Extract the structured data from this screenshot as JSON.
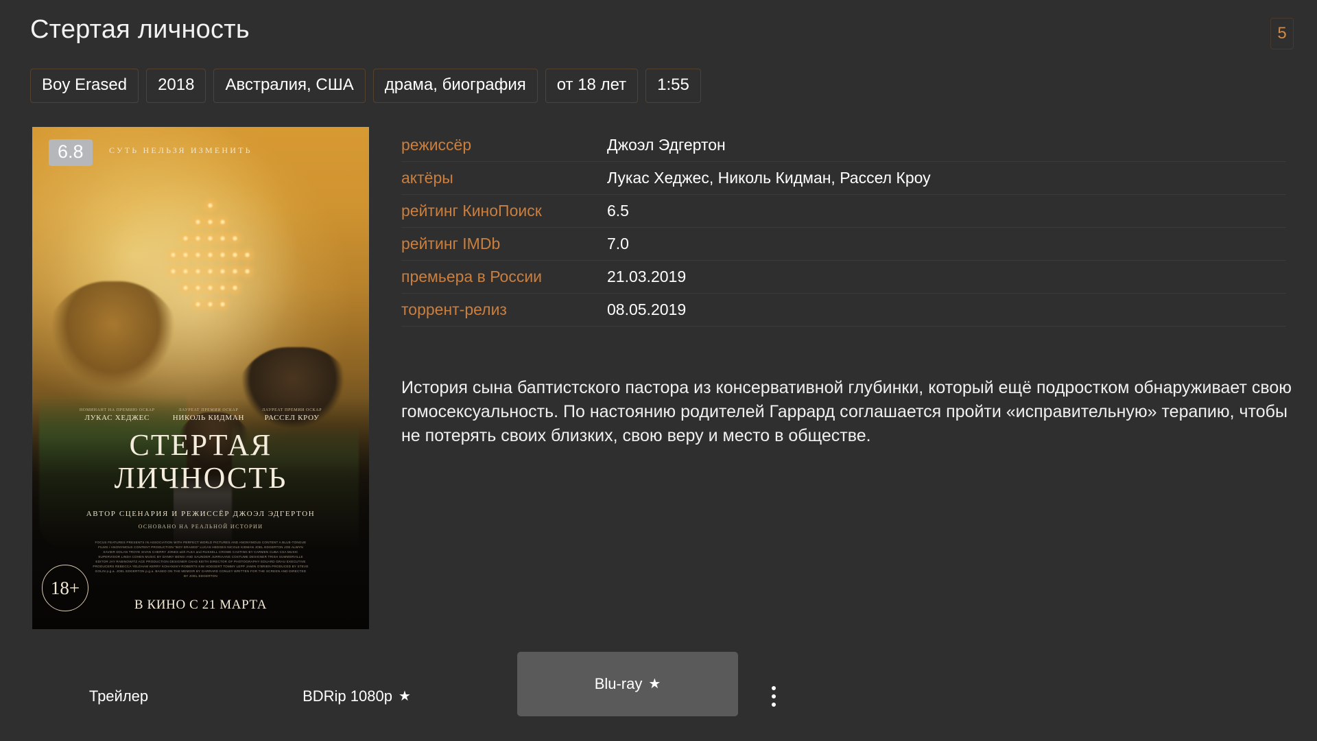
{
  "header": {
    "title": "Стертая личность",
    "count_badge": "5"
  },
  "chips": [
    {
      "label": "Boy Erased"
    },
    {
      "label": "2018"
    },
    {
      "label": "Австралия, США"
    },
    {
      "label": "драма, биография"
    },
    {
      "label": "от 18 лет"
    },
    {
      "label": "1:55"
    }
  ],
  "poster": {
    "score": "6.8",
    "tagline": "СУТЬ НЕЛЬЗЯ ИЗМЕНИТЬ",
    "credits": [
      {
        "award": "НОМИНАНТ НА ПРЕМИЮ ОСКАР",
        "name": "ЛУКАС ХЕДЖЕС"
      },
      {
        "award": "ЛАУРЕАТ ПРЕМИИ ОСКАР",
        "name": "НИКОЛЬ КИДМАН"
      },
      {
        "award": "ЛАУРЕАТ ПРЕМИИ ОСКАР",
        "name": "РАССЕЛ КРОУ"
      }
    ],
    "title_line1": "СТЕРТАЯ",
    "title_line2": "ЛИЧНОСТЬ",
    "director_credit": "АВТОР СЦЕНАРИЯ И РЕЖИССЁР ДЖОЭЛ ЭДГЕРТОН",
    "based_on": "ОСНОВАНО НА РЕАЛЬНОЙ ИСТОРИИ",
    "billing_block": "FOCUS FEATURES PRESENTS IN ASSOCIATION WITH PERFECT WORLD PICTURES AND ANONYMOUS CONTENT A BLUE-TONGUE FILMS / ANONYMOUS CONTENT PRODUCTION \"BOY ERASED\" LUCAS HEDGES NICOLE KIDMAN JOEL EDGERTON JOE ALWYN XAVIER DOLAN TROYE SIVAN CHERRY JONES with FLEA and RUSSELL CROWE CASTING BY CARMEN CUBA CSA MUSIC SUPERVISOR LINDA COHEN MUSIC BY DANNY BENSI AND SAUNDER JURRIAANS COSTUME DESIGNER TRISH SUMMERVILLE EDITOR JAY RABINOWITZ ACE PRODUCTION DESIGNER CHAD KEITH DIRECTOR OF PHOTOGRAPHY EDUARD GRAU EXECUTIVE PRODUCERS REBECCA YELDHAM KERRY KOHANSKY-ROBERTS KIM HODGERT TOMMY LEPP JAMIN O'BRIEN PRODUCED BY STEVE GOLIN p.g.a. JOEL EDGERTON p.g.a. BASED ON THE MEMOIR BY GARRARD CONLEY WRITTEN FOR THE SCREEN AND DIRECTED BY JOEL EDGERTON",
    "age_rating": "18+",
    "release_note": "В КИНО С 21 МАРТА"
  },
  "info": {
    "rows": [
      {
        "label": "режиссёр",
        "value": "Джоэл Эдгертон"
      },
      {
        "label": "актёры",
        "value": "Лукас Хеджес, Николь Кидман, Рассел Кроу"
      },
      {
        "label": "рейтинг КиноПоиск",
        "value": "6.5"
      },
      {
        "label": "рейтинг IMDb",
        "value": "7.0"
      },
      {
        "label": "премьера в России",
        "value": "21.03.2019"
      },
      {
        "label": "торрент-релиз",
        "value": "08.05.2019"
      }
    ],
    "description": "История сына баптистского пастора из консервативной глубинки, который ещё подростком обнаруживает свою гомосексуальность. По настоянию родителей Гаррард соглашается пройти «исправительную» терапию, чтобы не потерять своих близких, свою веру и место в обществе."
  },
  "toolbar": {
    "trailer_label": "Трейлер",
    "bdrip_label": "BDRip 1080p",
    "bdrip_star": "★",
    "bluray_label": "Blu-ray",
    "bluray_star": "★"
  },
  "colors": {
    "background": "#2f2f2f",
    "accent_orange": "#cb7f3e",
    "focus_button": "#5a5a5a",
    "text_primary": "#ffffff",
    "separator": "#3b3b3b"
  }
}
